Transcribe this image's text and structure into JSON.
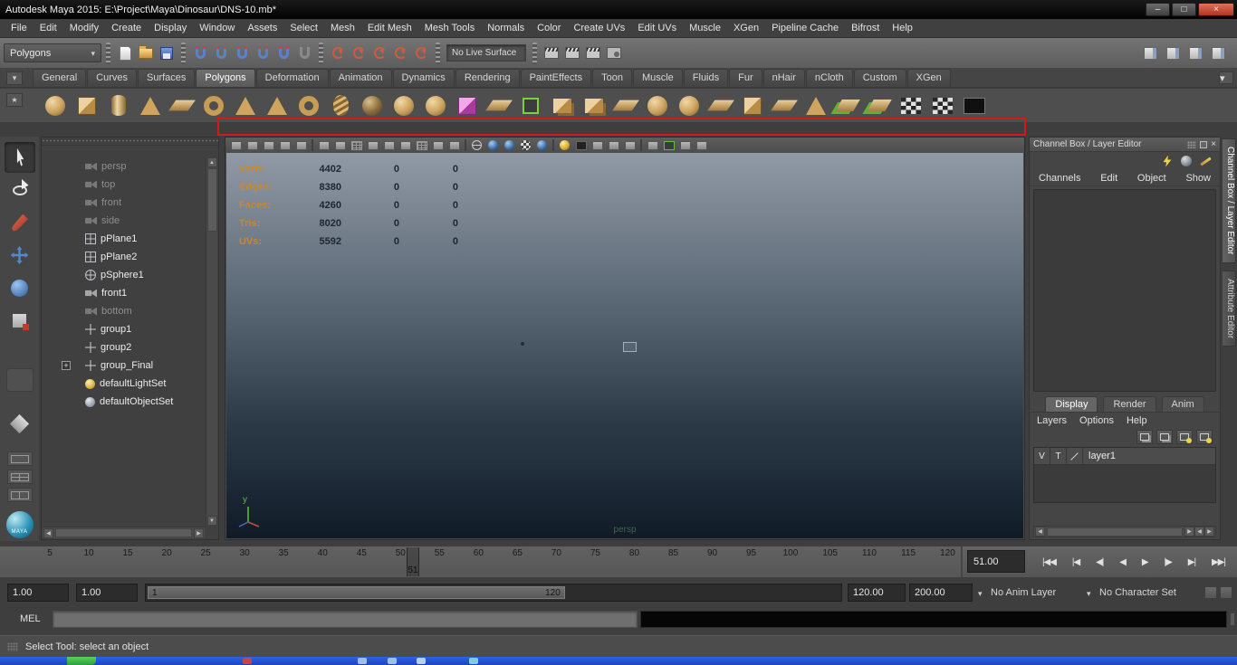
{
  "window": {
    "title": "Autodesk Maya 2015: E:\\Project\\Maya\\Dinosaur\\DNS-10.mb*",
    "controls": [
      {
        "name": "minimize-button",
        "glyph": "–"
      },
      {
        "name": "maximize-button",
        "glyph": "□"
      },
      {
        "name": "close-button",
        "glyph": "×",
        "close": true
      }
    ]
  },
  "menu_bar": [
    "File",
    "Edit",
    "Modify",
    "Create",
    "Display",
    "Window",
    "Assets",
    "Select",
    "Mesh",
    "Edit Mesh",
    "Mesh Tools",
    "Normals",
    "Color",
    "Create UVs",
    "Edit UVs",
    "Muscle",
    "XGen",
    "Pipeline Cache",
    "Bifrost",
    "Help"
  ],
  "status_line": {
    "mode": "Polygons",
    "live_surface": "No Live Surface",
    "file_icons": [
      {
        "name": "new-scene-icon",
        "kind": "file-new"
      },
      {
        "name": "open-scene-icon",
        "kind": "folder"
      },
      {
        "name": "save-scene-icon",
        "kind": "save"
      }
    ],
    "snap_icons": [
      {
        "name": "snap-to-grids-icon",
        "kind": "magnet"
      },
      {
        "name": "snap-to-curves-icon",
        "kind": "magnet"
      },
      {
        "name": "snap-to-points-icon",
        "kind": "magnet"
      },
      {
        "name": "snap-to-projected-center-icon",
        "kind": "magnet"
      },
      {
        "name": "snap-to-view-planes-icon",
        "kind": "magnet"
      },
      {
        "name": "make-object-live-icon",
        "kind": "magnet-dark"
      }
    ],
    "history_icons": [
      {
        "name": "input-to-selected-icon",
        "kind": "history"
      },
      {
        "name": "output-from-selected-icon",
        "kind": "history"
      },
      {
        "name": "input-output-connections-icon",
        "kind": "history"
      },
      {
        "name": "construction-history-on-icon",
        "kind": "history"
      },
      {
        "name": "construction-history-off-icon",
        "kind": "history"
      }
    ],
    "render_icons": [
      {
        "name": "open-render-view-icon",
        "kind": "clap"
      },
      {
        "name": "render-current-frame-icon",
        "kind": "clap"
      },
      {
        "name": "ipr-render-icon",
        "kind": "clap"
      },
      {
        "name": "render-settings-icon",
        "kind": "clap-gear"
      }
    ],
    "right_icons": [
      {
        "name": "show-modeling-toolkit-icon",
        "kind": "panel"
      },
      {
        "name": "show-attribute-editor-icon",
        "kind": "panel"
      },
      {
        "name": "show-tool-settings-icon",
        "kind": "panel"
      },
      {
        "name": "show-channel-box-icon",
        "kind": "panel"
      }
    ]
  },
  "shelf": {
    "tabs": [
      {
        "label": "General"
      },
      {
        "label": "Curves"
      },
      {
        "label": "Surfaces"
      },
      {
        "label": "Polygons",
        "active": true
      },
      {
        "label": "Deformation"
      },
      {
        "label": "Animation"
      },
      {
        "label": "Dynamics"
      },
      {
        "label": "Rendering"
      },
      {
        "label": "PaintEffects"
      },
      {
        "label": "Toon"
      },
      {
        "label": "Muscle"
      },
      {
        "label": "Fluids"
      },
      {
        "label": "Fur"
      },
      {
        "label": "nHair"
      },
      {
        "label": "nCloth"
      },
      {
        "label": "Custom"
      },
      {
        "label": "XGen"
      }
    ],
    "icons": [
      {
        "name": "poly-sphere-icon",
        "shape": "circle"
      },
      {
        "name": "poly-cube-icon",
        "shape": "cube"
      },
      {
        "name": "poly-cylinder-icon",
        "shape": "cylinder"
      },
      {
        "name": "poly-cone-icon",
        "shape": "cone"
      },
      {
        "name": "poly-plane-icon",
        "shape": "plane"
      },
      {
        "name": "poly-torus-icon",
        "shape": "ring"
      },
      {
        "name": "poly-prism-icon",
        "shape": "cone"
      },
      {
        "name": "poly-pyramid-icon",
        "shape": "cone"
      },
      {
        "name": "poly-pipe-icon",
        "shape": "ring"
      },
      {
        "name": "poly-helix-icon",
        "shape": "helix"
      },
      {
        "name": "poly-soccer-ball-icon",
        "shape": "circle-dark"
      },
      {
        "name": "poly-platonic-solid-icon",
        "shape": "circle"
      },
      {
        "name": "sculpt-geometry-icon",
        "shape": "circle"
      },
      {
        "name": "uv-planar-mapping-icon",
        "shape": "pink-cube"
      },
      {
        "name": "fold-plane-icon",
        "shape": "plane"
      },
      {
        "name": "component-pick-icon",
        "shape": "bracket"
      },
      {
        "name": "combine-icon",
        "shape": "cube-pair"
      },
      {
        "name": "separate-icon",
        "shape": "cube-pair"
      },
      {
        "name": "extract-icon",
        "shape": "plane"
      },
      {
        "name": "boolean-union-icon",
        "shape": "circle"
      },
      {
        "name": "smooth-icon",
        "shape": "circle"
      },
      {
        "name": "mirror-geometry-icon",
        "shape": "plane"
      },
      {
        "name": "bevel-icon",
        "shape": "cube"
      },
      {
        "name": "bridge-icon",
        "shape": "plane"
      },
      {
        "name": "extrude-icon",
        "shape": "cone"
      },
      {
        "name": "snap-together-icon",
        "shape": "green-plane"
      },
      {
        "name": "target-weld-icon",
        "shape": "green-plane"
      },
      {
        "name": "uv-checker-map-icon",
        "shape": "checker"
      },
      {
        "name": "uv-snapshot-icon",
        "shape": "checker"
      },
      {
        "name": "uv-texture-editor-icon",
        "shape": "dark"
      }
    ]
  },
  "toolbox": {
    "tools": [
      {
        "name": "select-tool",
        "icon": "select",
        "active": true
      },
      {
        "name": "lasso-select-tool",
        "icon": "lasso"
      },
      {
        "name": "paint-select-tool",
        "icon": "paint"
      },
      {
        "name": "move-tool",
        "icon": "move"
      },
      {
        "name": "rotate-tool",
        "icon": "rotate"
      },
      {
        "name": "scale-tool",
        "icon": "scale"
      },
      {
        "name": "last-tool-slot",
        "icon": "empty"
      }
    ],
    "layout_buttons": [
      {
        "name": "single-pane-layout-button",
        "kind": "pane-single"
      },
      {
        "name": "four-pane-layout-button",
        "kind": "pane-four"
      },
      {
        "name": "two-pane-layout-button",
        "kind": "pane-two"
      }
    ],
    "logo_text": "MAYA"
  },
  "outliner": {
    "items": [
      {
        "label": "persp",
        "icon": "camera",
        "dim": true
      },
      {
        "label": "top",
        "icon": "camera",
        "dim": true
      },
      {
        "label": "front",
        "icon": "camera",
        "dim": true
      },
      {
        "label": "side",
        "icon": "camera",
        "dim": true
      },
      {
        "label": "pPlane1",
        "icon": "mesh"
      },
      {
        "label": "pPlane2",
        "icon": "mesh"
      },
      {
        "label": "pSphere1",
        "icon": "mesh-sphere"
      },
      {
        "label": "front1",
        "icon": "camera"
      },
      {
        "label": "bottom",
        "icon": "camera",
        "dim": true
      },
      {
        "label": "group1",
        "icon": "group"
      },
      {
        "label": "group2",
        "icon": "group"
      },
      {
        "label": "group_Final",
        "icon": "group",
        "expandable": true
      },
      {
        "label": "defaultLightSet",
        "icon": "light-set"
      },
      {
        "label": "defaultObjectSet",
        "icon": "object-set"
      }
    ]
  },
  "viewport": {
    "camera_label": "persp",
    "axis_label": "y",
    "hud_rows": [
      {
        "label": "Verts:",
        "c1": "4402",
        "c2": "0",
        "c3": "0"
      },
      {
        "label": "Edges:",
        "c1": "8380",
        "c2": "0",
        "c3": "0"
      },
      {
        "label": "Faces:",
        "c1": "4260",
        "c2": "0",
        "c3": "0"
      },
      {
        "label": "Tris:",
        "c1": "8020",
        "c2": "0",
        "c3": "0"
      },
      {
        "label": "UVs:",
        "c1": "5592",
        "c2": "0",
        "c3": "0"
      }
    ],
    "toolbar_icons": [
      {
        "name": "select-camera-icon",
        "kind": "gray"
      },
      {
        "name": "lock-camera-icon",
        "kind": "gray"
      },
      {
        "name": "camera-attributes-icon",
        "kind": "gray"
      },
      {
        "name": "bookmark-icon",
        "kind": "gray"
      },
      {
        "name": "image-plane-icon",
        "kind": "gray"
      },
      {
        "name": "separator",
        "kind": "sep",
        "sep": true
      },
      {
        "name": "2d-pan-zoom-icon",
        "kind": "gray"
      },
      {
        "name": "grease-pencil-icon",
        "kind": "gray"
      },
      {
        "name": "grid-icon",
        "kind": "grid"
      },
      {
        "name": "film-gate-icon",
        "kind": "gray"
      },
      {
        "name": "resolution-gate-icon",
        "kind": "gray"
      },
      {
        "name": "gate-mask-icon",
        "kind": "gray"
      },
      {
        "name": "field-chart-icon",
        "kind": "grid"
      },
      {
        "name": "safe-action-icon",
        "kind": "gray"
      },
      {
        "name": "safe-title-icon",
        "kind": "gray"
      },
      {
        "name": "separator",
        "kind": "sep",
        "sep": true
      },
      {
        "name": "wireframe-icon",
        "kind": "sphere-wire"
      },
      {
        "name": "smooth-shade-all-icon",
        "kind": "sphere-blue"
      },
      {
        "name": "wireframe-on-shaded-icon",
        "kind": "sphere-blue"
      },
      {
        "name": "textured-icon",
        "kind": "sphere-check"
      },
      {
        "name": "use-default-material-icon",
        "kind": "sphere-blue"
      },
      {
        "name": "separator",
        "kind": "sep",
        "sep": true
      },
      {
        "name": "lighting-icon",
        "kind": "yellow"
      },
      {
        "name": "shadows-icon",
        "kind": "dark"
      },
      {
        "name": "screen-space-ao-icon",
        "kind": "gray"
      },
      {
        "name": "motion-blur-icon",
        "kind": "gray"
      },
      {
        "name": "multisample-anti-aliasing-icon",
        "kind": "gray"
      },
      {
        "name": "separator",
        "kind": "sep",
        "sep": true
      },
      {
        "name": "xray-icon",
        "kind": "gray"
      },
      {
        "name": "isolate-select-icon",
        "kind": "green"
      },
      {
        "name": "exposure-icon",
        "kind": "gray"
      },
      {
        "name": "gamma-icon",
        "kind": "gray"
      }
    ]
  },
  "channel_box": {
    "title": "Channel Box / Layer Editor",
    "menus": [
      "Channels",
      "Edit",
      "Object",
      "Show"
    ],
    "quick_icons": [
      {
        "name": "speed-control-icon",
        "kind": "bolt"
      },
      {
        "name": "hyperbolic-slider-icon",
        "kind": "sphere-gray"
      },
      {
        "name": "channel-edit-mode-icon",
        "kind": "pencil"
      }
    ],
    "display_tabs": [
      {
        "label": "Display",
        "active": true
      },
      {
        "label": "Render"
      },
      {
        "label": "Anim"
      }
    ],
    "layer_menus": [
      "Layers",
      "Options",
      "Help"
    ],
    "layer_icons": [
      {
        "name": "move-layer-up-icon",
        "kind": "layers"
      },
      {
        "name": "move-layer-down-icon",
        "kind": "layers"
      },
      {
        "name": "create-empty-layer-icon",
        "kind": "new-layer"
      },
      {
        "name": "create-layer-from-selected-icon",
        "kind": "new-layer"
      }
    ],
    "layers": [
      {
        "v": "V",
        "t": "T",
        "name": "layer1"
      }
    ]
  },
  "side_tabs": [
    {
      "label": "Channel Box / Layer Editor",
      "active": true
    },
    {
      "label": "Attribute Editor"
    }
  ],
  "time_slider": {
    "ticks": [
      "5",
      "10",
      "15",
      "20",
      "25",
      "30",
      "35",
      "40",
      "45",
      "50",
      "55",
      "60",
      "65",
      "70",
      "75",
      "80",
      "85",
      "90",
      "95",
      "100",
      "105",
      "110",
      "115",
      "120"
    ],
    "current_frame_label": "51",
    "current_time": "51.00"
  },
  "playback": {
    "buttons": [
      {
        "name": "go-to-start-button",
        "glyph": "|◀◀"
      },
      {
        "name": "step-back-key-button",
        "glyph": "|◀"
      },
      {
        "name": "step-back-frame-button",
        "glyph": "◀|"
      },
      {
        "name": "play-backwards-button",
        "glyph": "◀"
      },
      {
        "name": "play-forwards-button",
        "glyph": "▶"
      },
      {
        "name": "step-forward-frame-button",
        "glyph": "|▶"
      },
      {
        "name": "step-forward-key-button",
        "glyph": "▶|"
      },
      {
        "name": "go-to-end-button",
        "glyph": "▶▶|"
      }
    ]
  },
  "range_slider": {
    "anim_start": "1.00",
    "playback_start": "1.00",
    "range_start_label": "1",
    "range_end_label": "120",
    "playback_end": "120.00",
    "anim_end": "200.00",
    "anim_layer": "No Anim Layer",
    "character_set": "No Character Set"
  },
  "command_line": {
    "label": "MEL"
  },
  "help_line": {
    "message": "Select Tool: select an object"
  }
}
